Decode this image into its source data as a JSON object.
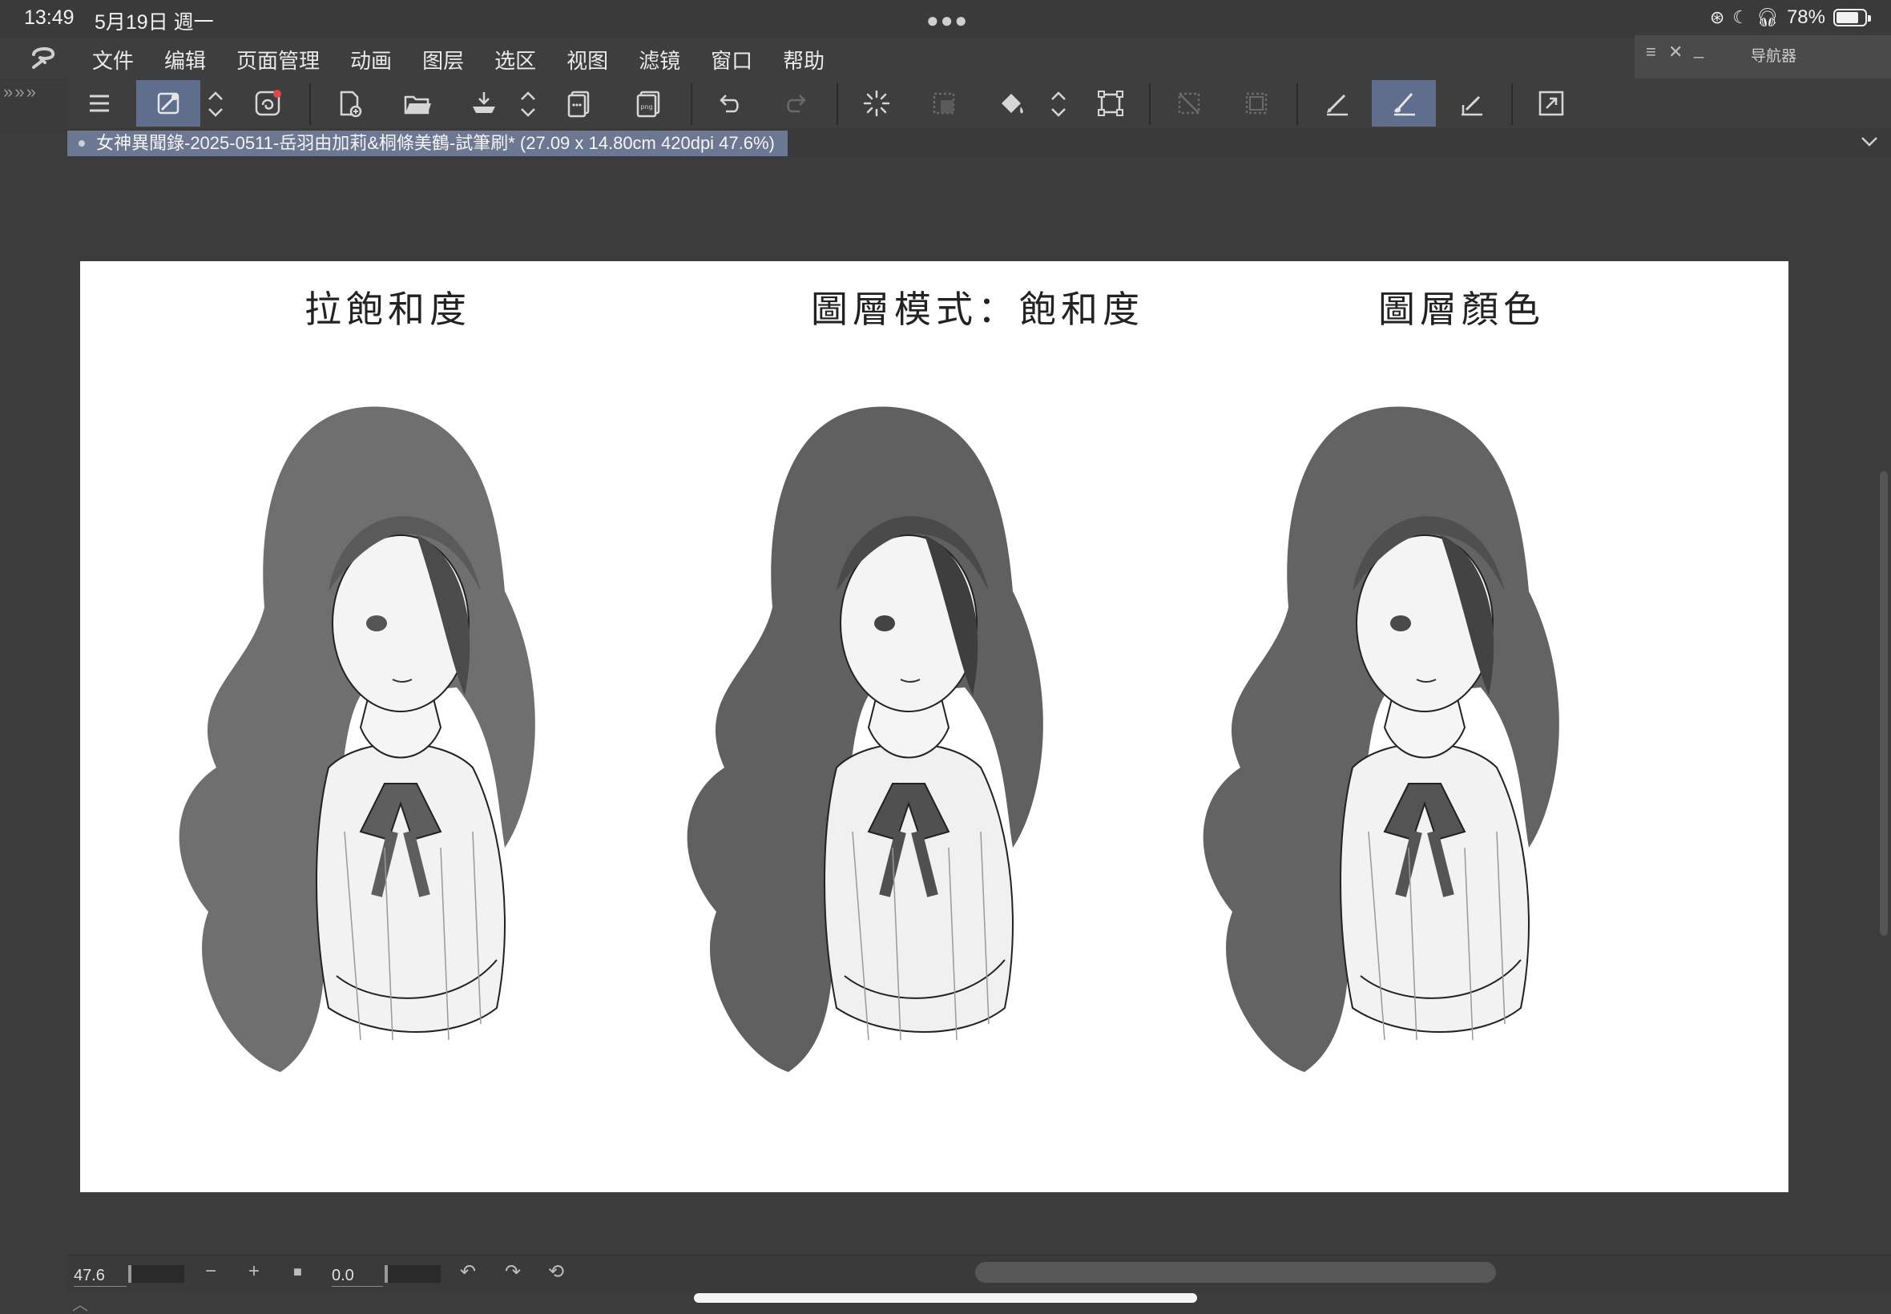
{
  "status_bar": {
    "time": "13:49",
    "date": "5月19日 週一",
    "battery": "78%",
    "battery_level": 0.78,
    "icons": [
      "orientation-lock-icon",
      "focus-icon",
      "headphones-icon",
      "battery-icon"
    ]
  },
  "menu": {
    "items": [
      "文件",
      "编辑",
      "页面管理",
      "动画",
      "图层",
      "选区",
      "视图",
      "滤镜",
      "窗口",
      "帮助"
    ]
  },
  "navigator": {
    "title": "导航器"
  },
  "toolbar": {
    "icons": [
      "menu-icon",
      "eyedropper-tool-icon",
      "companion-icon",
      "new-file-icon",
      "open-file-icon",
      "save-icon",
      "export-icon",
      "export-png-icon",
      "undo-icon",
      "redo-icon",
      "loading-icon",
      "crop-icon",
      "fill-icon",
      "transform-icon",
      "deselect-icon",
      "select-all-icon",
      "pen-tool-icon",
      "brush-tool-icon",
      "ruler-tool-icon",
      "fullscreen-icon"
    ]
  },
  "document": {
    "tab_title": "女神異聞錄-2025-0511-岳羽由加莉&桐條美鶴-試筆刷* (27.09 x 14.80cm 420dpi 47.6%)"
  },
  "canvas": {
    "captions": [
      "拉飽和度",
      "圖層模式：飽和度",
      "圖層顏色"
    ]
  },
  "bottom_bar": {
    "zoom": "47.6",
    "rotation": "0.0",
    "zoom_out": "−",
    "zoom_in": "+",
    "stop": "■",
    "rotate_left": "↶",
    "rotate_right": "↷",
    "reset": "⟲"
  },
  "colors": {
    "background": "#3c3c3c",
    "toolbar": "#3e3e3e",
    "active_tool": "#5f6e8c",
    "tab_active": "#6c7791",
    "canvas": "#ffffff"
  }
}
